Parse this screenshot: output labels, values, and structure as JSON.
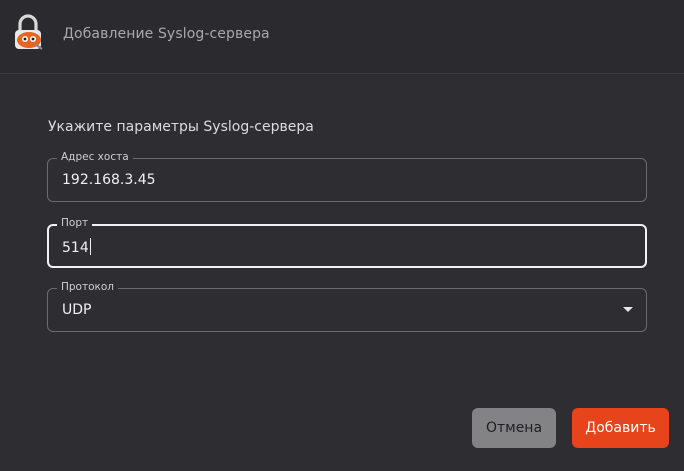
{
  "window": {
    "title": "Добавление Syslog-сервера",
    "icon": "lock-app-icon"
  },
  "form": {
    "prompt": "Укажите параметры Syslog-сервера",
    "host": {
      "label": "Адрес хоста",
      "value": "192.168.3.45"
    },
    "port": {
      "label": "Порт",
      "value": "514"
    },
    "protocol": {
      "label": "Протокол",
      "value": "UDP"
    }
  },
  "buttons": {
    "cancel": "Отмена",
    "add": "Добавить"
  },
  "colors": {
    "background": "#2e2e32",
    "accent": "#e8441b",
    "cancel_button": "#838386"
  }
}
